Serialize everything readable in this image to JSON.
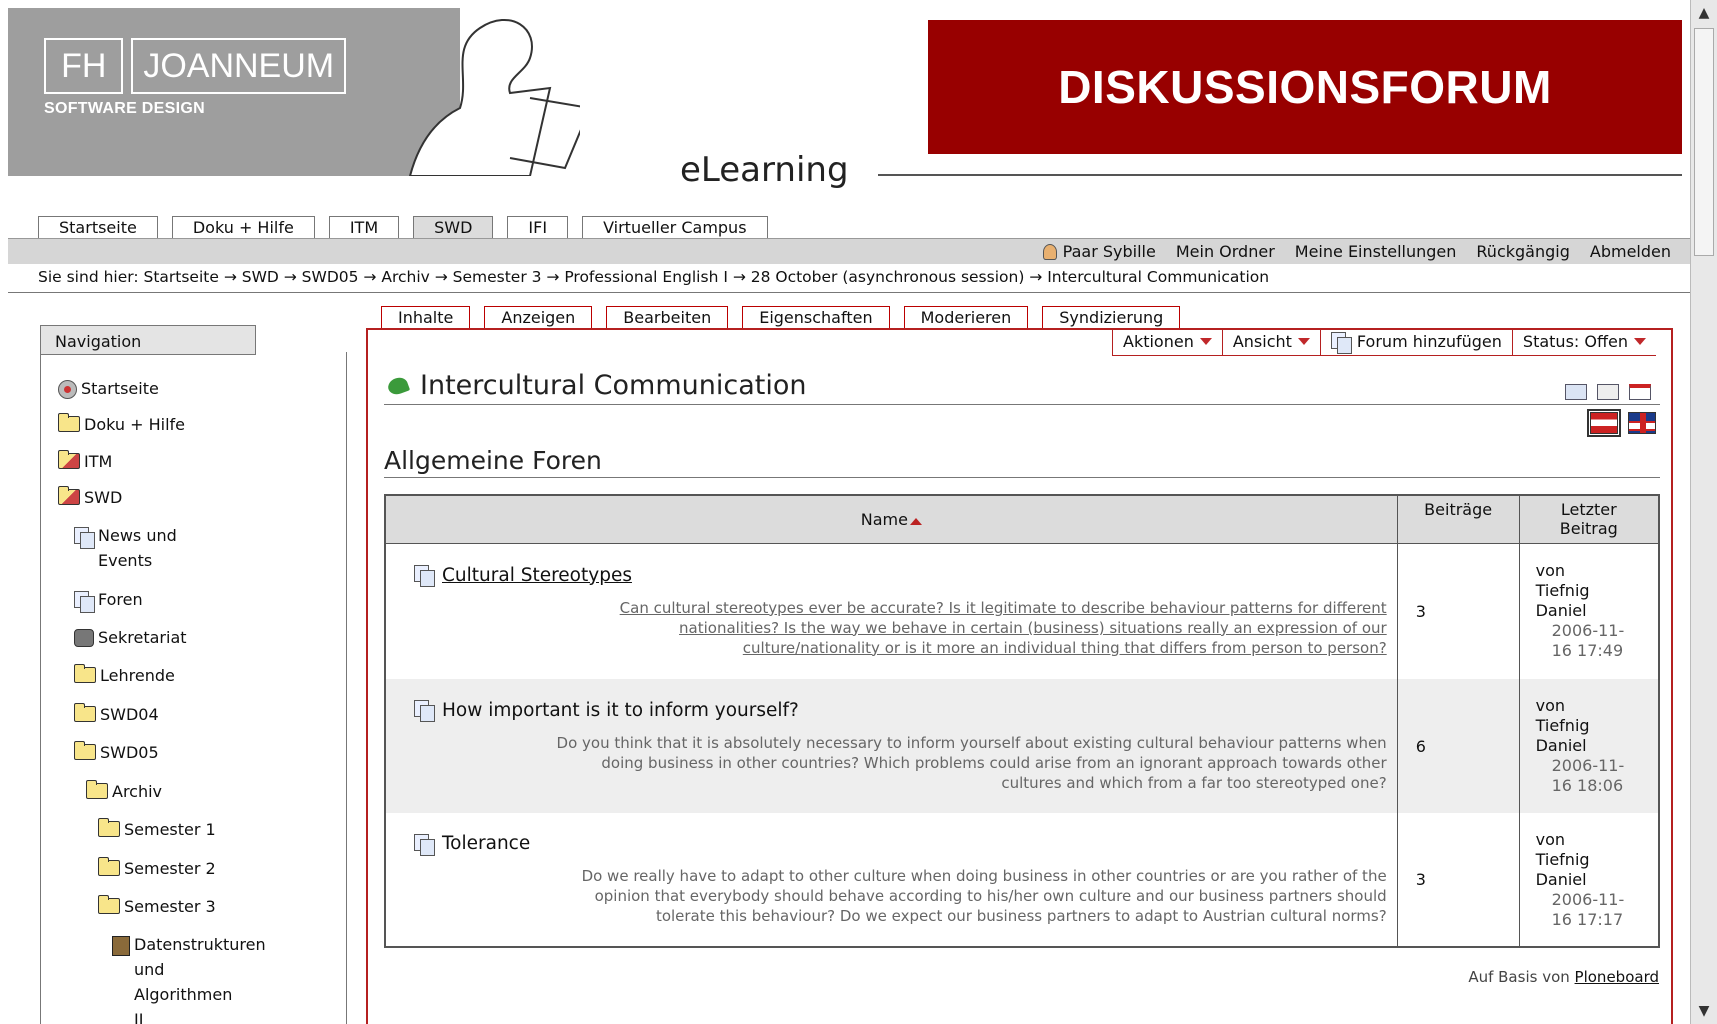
{
  "header": {
    "logo_left": "FH",
    "logo_right": "JOANNEUM",
    "logo_sub": "SOFTWARE DESIGN",
    "elearning": "eLearning",
    "banner": "DISKUSSIONSFORUM",
    "banner_color": "#980000"
  },
  "main_tabs": [
    {
      "label": "Startseite"
    },
    {
      "label": "Doku + Hilfe"
    },
    {
      "label": "ITM"
    },
    {
      "label": "SWD",
      "active": true
    },
    {
      "label": "IFI"
    },
    {
      "label": "Virtueller Campus"
    }
  ],
  "userbar": {
    "user": "Paar Sybille",
    "folder": "Mein Ordner",
    "settings": "Meine Einstellungen",
    "undo": "Rückgängig",
    "logout": "Abmelden"
  },
  "breadcrumb": "Sie sind hier: Startseite → SWD → SWD05 → Archiv → Semester 3 → Professional English I → 28 October (asynchronous session) → Intercultural Communication",
  "nav": {
    "title": "Navigation",
    "items": [
      {
        "label": "Startseite"
      },
      {
        "label": "Doku + Hilfe"
      },
      {
        "label": "ITM"
      },
      {
        "label": "SWD"
      },
      {
        "label": "News und"
      },
      {
        "label": "Events"
      },
      {
        "label": "Foren"
      },
      {
        "label": "Sekretariat"
      },
      {
        "label": "Lehrende"
      },
      {
        "label": "SWD04"
      },
      {
        "label": "SWD05"
      },
      {
        "label": "Archiv"
      },
      {
        "label": "Semester 1"
      },
      {
        "label": "Semester 2"
      },
      {
        "label": "Semester 3"
      },
      {
        "label": "Datenstrukturen"
      },
      {
        "label": "und"
      },
      {
        "label": "Algorithmen"
      },
      {
        "label": "II"
      }
    ]
  },
  "content_tabs": [
    {
      "label": "Inhalte"
    },
    {
      "label": "Anzeigen",
      "active": true
    },
    {
      "label": "Bearbeiten"
    },
    {
      "label": "Eigenschaften"
    },
    {
      "label": "Moderieren"
    },
    {
      "label": "Syndizierung"
    }
  ],
  "actions": {
    "aktionen": "Aktionen",
    "ansicht": "Ansicht",
    "add_forum": "Forum hinzufügen",
    "status": "Status: Offen"
  },
  "page": {
    "title": "Intercultural Communication",
    "section": "Allgemeine Foren"
  },
  "table": {
    "col_name": "Name",
    "col_posts": "Beiträge",
    "col_last_1": "Letzter",
    "col_last_2": "Beitrag",
    "rows": [
      {
        "title": "Cultural Stereotypes",
        "desc_1": "Can cultural stereotypes ever be accurate? Is it legitimate to describe behaviour patterns for different",
        "desc_2": "nationalities? Is the way we behave in certain (business) situations really an expression of our",
        "desc_3": "culture/nationality or is it more an individual thing that differs from person to person?",
        "posts": "3",
        "last_1": "von",
        "last_2": "Tiefnig",
        "last_3": "Daniel",
        "last_4": "2006-11-",
        "last_5": "16 17:49"
      },
      {
        "title": "How important is it to inform yourself?",
        "desc_1": "Do you think that it is absolutely necessary to inform yourself about existing cultural behaviour patterns when",
        "desc_2": "doing business in other countries? Which problems could arise from an ignorant approach towards other",
        "desc_3": "cultures and which from a far too stereotyped one?",
        "posts": "6",
        "last_1": "von",
        "last_2": "Tiefnig",
        "last_3": "Daniel",
        "last_4": "2006-11-",
        "last_5": "16 18:06"
      },
      {
        "title": "Tolerance",
        "desc_1": "Do we really have to adapt to other culture when doing business in other countries or are you rather of the",
        "desc_2": "opinion that everybody should behave according to his/her own culture and our business partners should",
        "desc_3": "tolerate this behaviour? Do we expect our business partners to adapt to Austrian cultural norms?",
        "posts": "3",
        "last_1": "von",
        "last_2": "Tiefnig",
        "last_3": "Daniel",
        "last_4": "2006-11-",
        "last_5": "16 17:17"
      }
    ]
  },
  "footer": {
    "prefix": "Auf Basis von",
    "link": "Ploneboard"
  }
}
